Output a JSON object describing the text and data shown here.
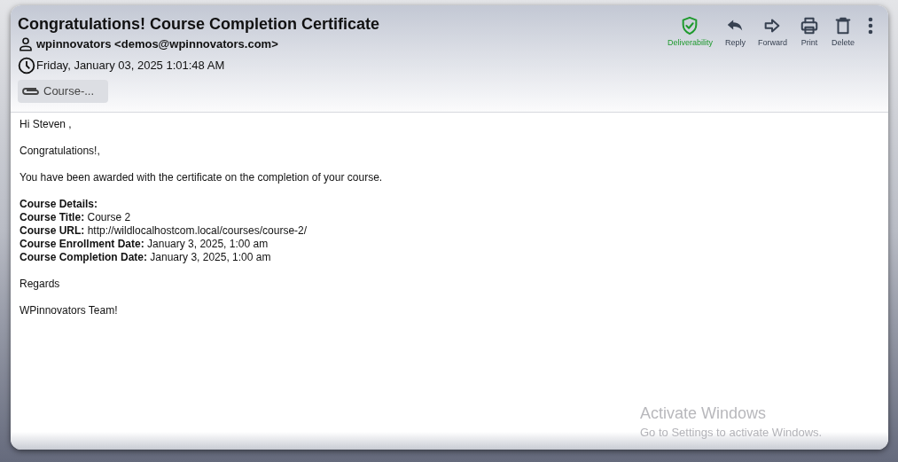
{
  "email": {
    "subject": "Congratulations! Course Completion Certificate",
    "sender": "wpinnovators <demos@wpinnovators.com>",
    "date": "Friday, January 03, 2025 1:01:48 AM",
    "attachment": "Course-..."
  },
  "actions": [
    {
      "kind": "shield",
      "label": "Deliverability"
    },
    {
      "kind": "reply",
      "label": "Reply"
    },
    {
      "kind": "forward",
      "label": "Forward"
    },
    {
      "kind": "print",
      "label": "Print"
    },
    {
      "kind": "delete",
      "label": "Delete"
    },
    {
      "kind": "more"
    }
  ],
  "body": [
    [
      "Hi Steven ,"
    ],
    [
      "Congratulations!,"
    ],
    [
      "You have been awarded with the certificate on the completion of your course."
    ],
    [
      "**Course Details:**",
      "**Course Title:** Course 2",
      "**Course URL:** http://wildlocalhostcom.local/courses/course-2/",
      "**Course Enrollment Date:** January 3, 2025, 1:00 am",
      "**Course Completion Date:** January 3, 2025, 1:00 am"
    ],
    [
      "Regards"
    ],
    [
      "WPinnovators Team!"
    ]
  ],
  "os_overlay": {
    "title": "Activate Windows",
    "subtitle": "Go to Settings to activate Windows."
  }
}
